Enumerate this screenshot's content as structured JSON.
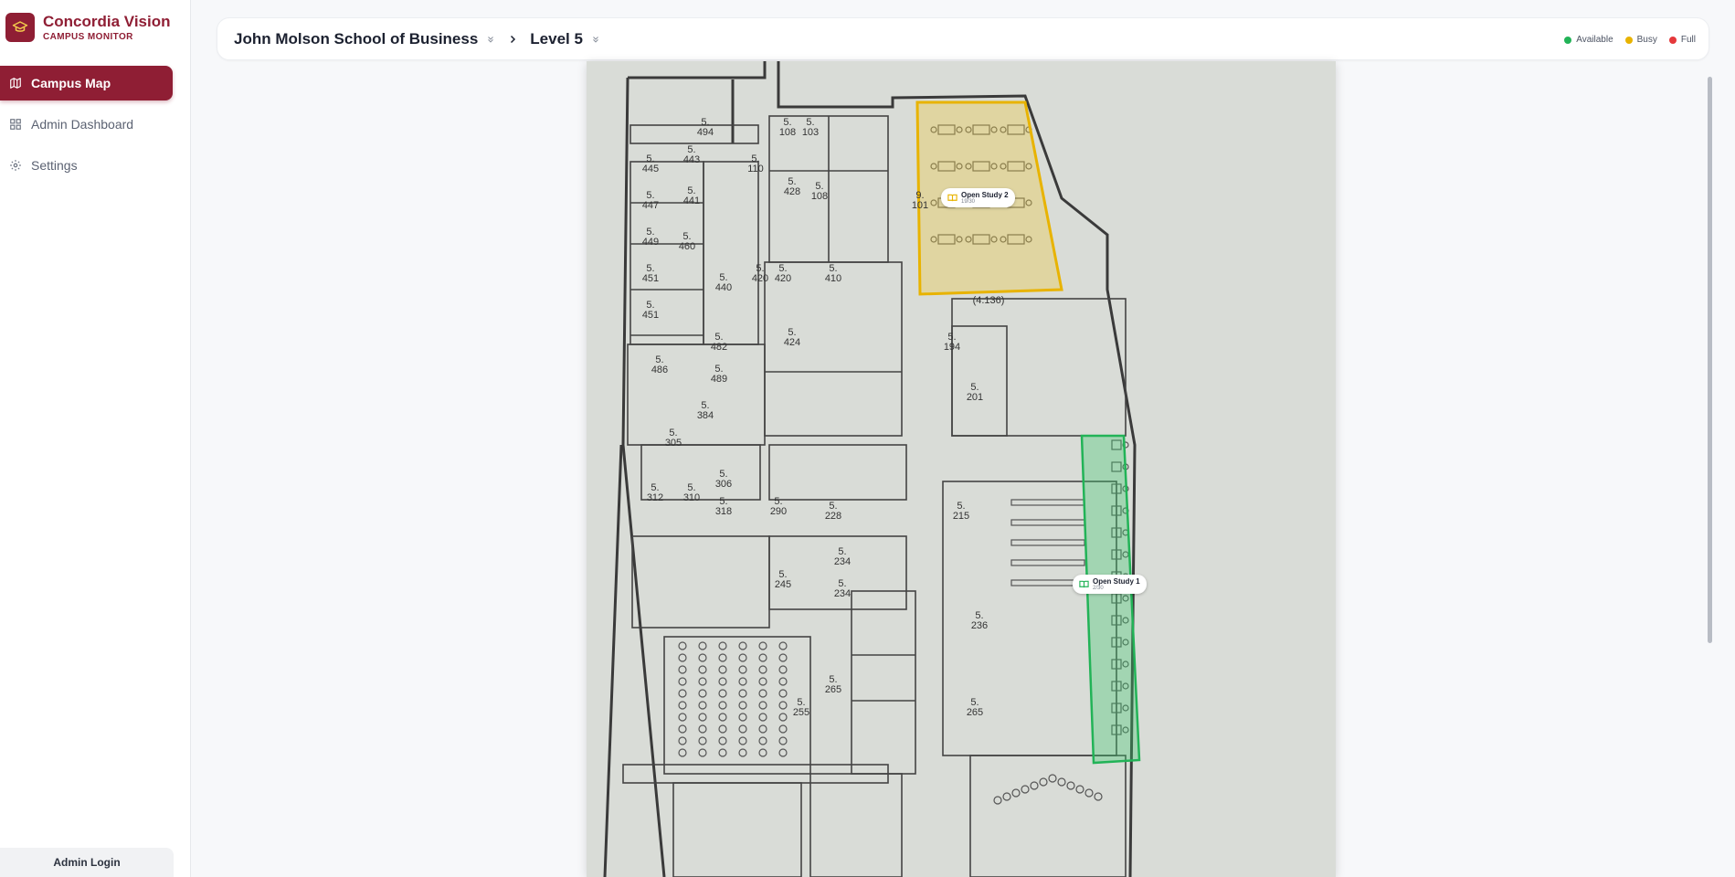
{
  "brand": {
    "title": "Concordia Vision",
    "subtitle": "CAMPUS MONITOR",
    "logo_icon": "graduation-cap-icon"
  },
  "nav": [
    {
      "label": "Campus Map",
      "icon": "map-icon",
      "active": true
    },
    {
      "label": "Admin Dashboard",
      "icon": "grid-icon",
      "active": false
    },
    {
      "label": "Settings",
      "icon": "gear-icon",
      "active": false
    }
  ],
  "admin_login": "Admin Login",
  "header": {
    "building": "John Molson School of Business",
    "level": "Level 5"
  },
  "legend": [
    {
      "label": "Available",
      "color": "#22b357"
    },
    {
      "label": "Busy",
      "color": "#e8b300"
    },
    {
      "label": "Full",
      "color": "#e5383b"
    }
  ],
  "zones": [
    {
      "name": "Open Study 2",
      "count": "19/30",
      "status": "busy",
      "color": "#e8b300"
    },
    {
      "name": "Open Study 1",
      "count": "2/30",
      "status": "available",
      "color": "#22b357"
    }
  ],
  "rooms": [
    "5.494",
    "5.108",
    "5.103",
    "5.445",
    "5.443",
    "5.110",
    "5.428",
    "5.108",
    "5.447",
    "5.441",
    "9.101",
    "5.449",
    "5.460",
    "5.420",
    "5.420",
    "5.410",
    "5.451",
    "5.440",
    "5.451",
    "(4.136)",
    "5.482",
    "5.424",
    "5.194",
    "5.486",
    "5.489",
    "5.201",
    "5.384",
    "5.305",
    "5.306",
    "5.312",
    "5.310",
    "5.318",
    "5.290",
    "5.228",
    "5.215",
    "5.234",
    "5.245",
    "5.234",
    "5.236",
    "5.265",
    "5.255",
    "5.265"
  ]
}
